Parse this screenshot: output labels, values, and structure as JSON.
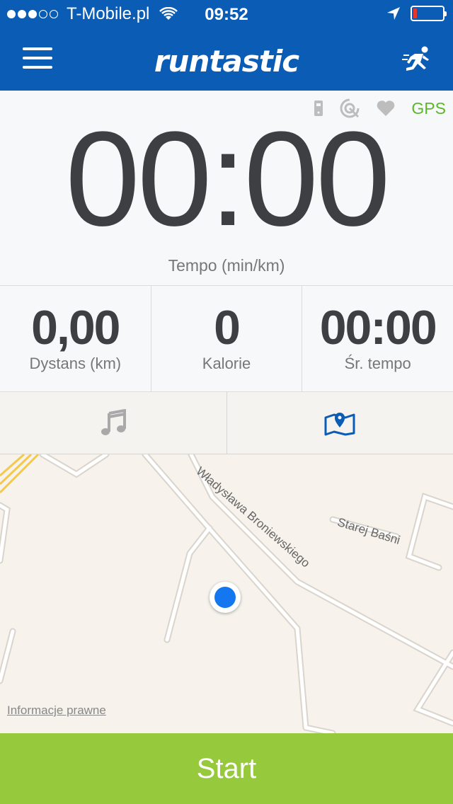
{
  "status_bar": {
    "carrier": "T-Mobile.pl",
    "time": "09:52",
    "battery_color": "#e5372b"
  },
  "header": {
    "app_name": "runtastic",
    "menu_icon": "hamburger-menu-icon",
    "activity_icon": "runner-icon",
    "bar_color": "#0a5cb4"
  },
  "sensors": {
    "gps_label": "GPS",
    "gps_color": "#5cb82a"
  },
  "timer": {
    "value": "00:00",
    "label": "Tempo (min/km)"
  },
  "stats": [
    {
      "value": "0,00",
      "label": "Dystans (km)"
    },
    {
      "value": "0",
      "label": "Kalorie"
    },
    {
      "value": "00:00",
      "label": "Śr. tempo"
    }
  ],
  "tabs": {
    "music_icon": "music-note-icon",
    "map_icon": "map-pin-icon"
  },
  "map": {
    "street_1": "Władysława Broniewskiego",
    "street_2": "Starej Baśni",
    "legal_link": "Informacje prawne"
  },
  "action": {
    "start_label": "Start",
    "button_color": "#96c93b"
  }
}
